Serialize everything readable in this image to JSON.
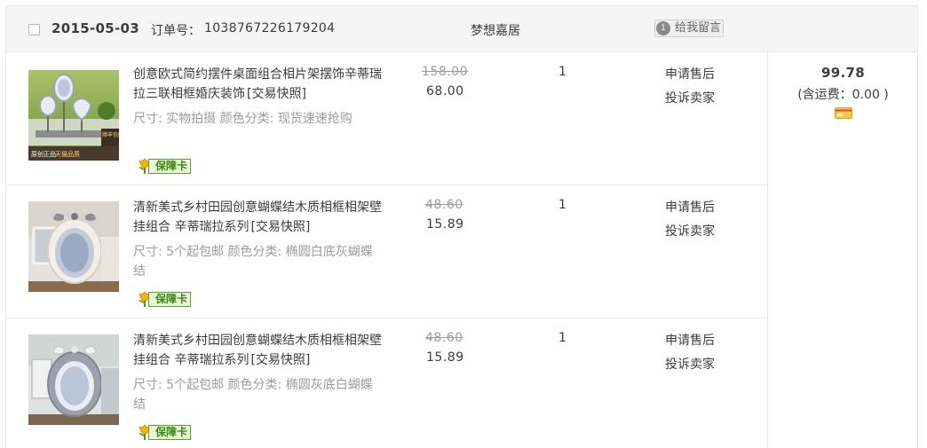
{
  "header": {
    "date": "2015-05-03",
    "order_label": "订单号：",
    "order_no": "1038767226179204",
    "shop": "梦想嘉居",
    "message_button": "给我留言",
    "message_icon_text": "1"
  },
  "items": [
    {
      "title": "创意欧式简约摆件桌面组合相片架摆饰辛蒂瑞拉三联相框婚庆装饰",
      "snapshot": "[交易快照]",
      "spec": "尺寸: 实物拍摄 颜色分类: 现货速速抢购",
      "badge": "保障卡",
      "price_original": "158.00",
      "price_actual": "68.00",
      "quantity": "1",
      "action_after_sale": "申请售后",
      "action_complain": "投诉卖家",
      "thumb_stamp_left": "原创正品",
      "thumb_stamp_mid": "天猫品质",
      "thumb_stamp_right": "顺丰包邮",
      "thumb_icon": "photo-frame-trio-icon"
    },
    {
      "title": "清新美式乡村田园创意蝴蝶结木质相框相架壁挂组合 辛蒂瑞拉系列",
      "snapshot": "[交易快照]",
      "spec": "尺寸: 5个起包邮 颜色分类: 椭圆白底灰蝴蝶结",
      "badge": "保障卡",
      "price_original": "48.60",
      "price_actual": "15.89",
      "quantity": "1",
      "action_after_sale": "申请售后",
      "action_complain": "投诉卖家",
      "thumb_icon": "oval-bow-frame-icon"
    },
    {
      "title": "清新美式乡村田园创意蝴蝶结木质相框相架壁挂组合 辛蒂瑞拉系列",
      "snapshot": "[交易快照]",
      "spec": "尺寸: 5个起包邮 颜色分类: 椭圆灰底白蝴蝶结",
      "badge": "保障卡",
      "price_original": "48.60",
      "price_actual": "15.89",
      "quantity": "1",
      "action_after_sale": "申请售后",
      "action_complain": "投诉卖家",
      "thumb_icon": "oval-bow-frame-icon"
    }
  ],
  "total": {
    "amount": "99.78",
    "shipping": "(含运费：0.00 )",
    "card_icon": "credit-card-icon"
  },
  "colors": {
    "header_bg": "#f5f5f5",
    "border": "#e6e6e6",
    "text": "#3c3c3c",
    "muted": "#9c9c9c",
    "badge_green": "#5aa02c",
    "badge_bg": "#eaf6d9"
  }
}
